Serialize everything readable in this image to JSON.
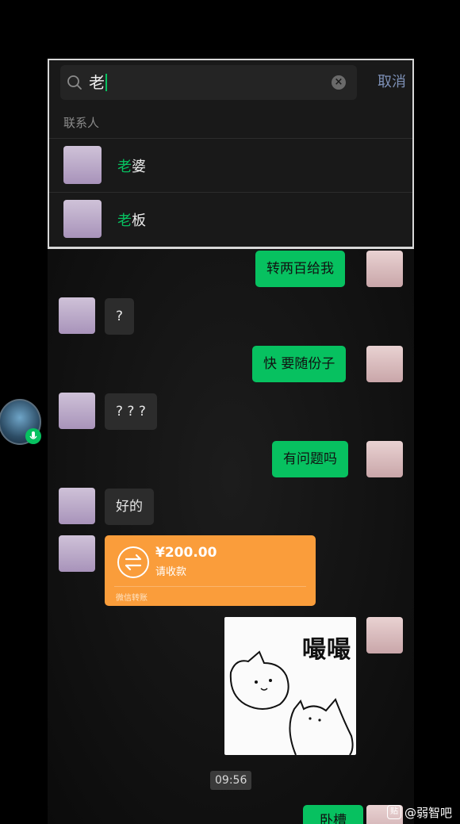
{
  "search": {
    "query": "老",
    "cancel_label": "取消",
    "section_label": "联系人",
    "results": [
      {
        "highlight": "老",
        "rest": "婆"
      },
      {
        "highlight": "老",
        "rest": "板"
      }
    ]
  },
  "messages": [
    {
      "text": "转两百给我"
    },
    {
      "text": "?"
    },
    {
      "text": "快 要随份子"
    },
    {
      "text": "? ? ?"
    },
    {
      "text": "有问题吗"
    },
    {
      "text": "好的"
    }
  ],
  "transfer": {
    "amount": "¥200.00",
    "status": "请收款",
    "label": "微信转账"
  },
  "sticker": {
    "text": "嘬嘬"
  },
  "timestamp": "09:56",
  "partial_message": "卧槽",
  "watermark": {
    "logo": "贴",
    "text": "@弱智吧"
  },
  "colors": {
    "accent_green": "#07c160",
    "transfer_orange": "#fa9d3b",
    "cancel_blue": "#7d90b6"
  }
}
